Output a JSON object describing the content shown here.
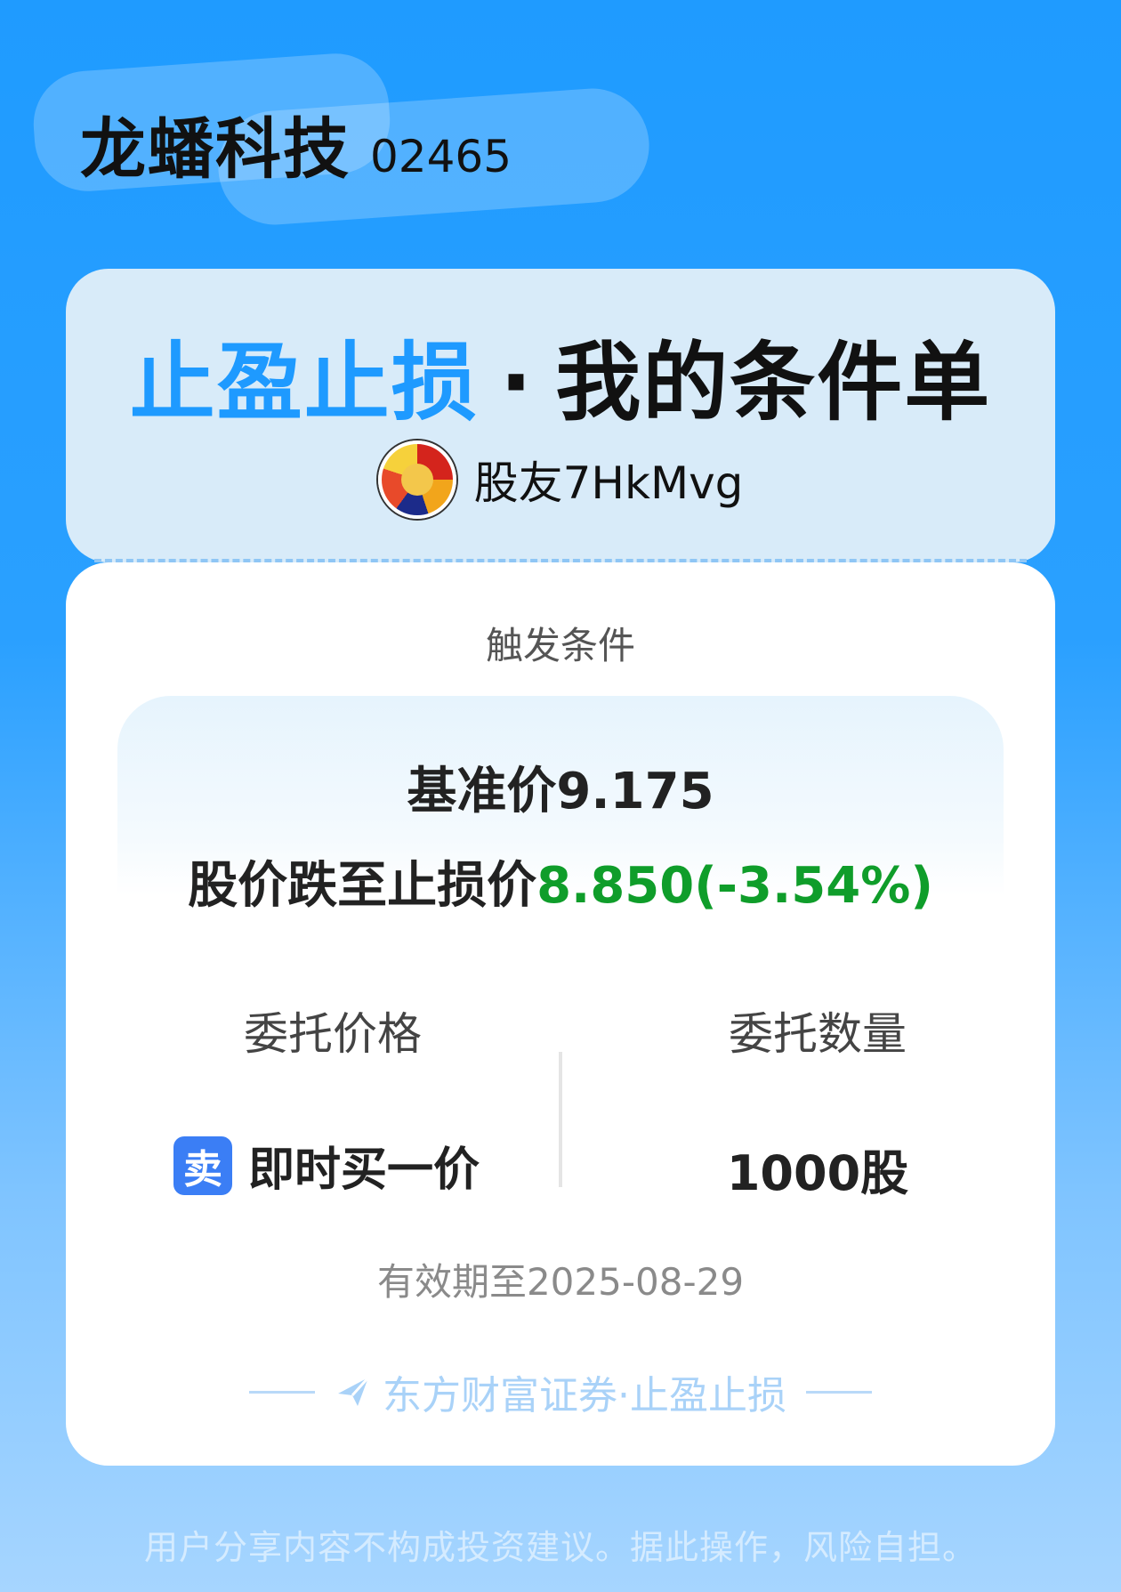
{
  "stock": {
    "name": "龙蟠科技",
    "code": "02465"
  },
  "card": {
    "title_blue": "止盈止损",
    "title_separator": "·",
    "title_black": "我的条件单",
    "username": "股友7HkMvg",
    "avatar_icon": "avatar-image"
  },
  "condition": {
    "label": "触发条件",
    "base_price_text": "基准价9.175",
    "stop_prefix": "股价跌至止损价",
    "stop_value": "8.850(-3.54%)"
  },
  "order": {
    "price_label": "委托价格",
    "quantity_label": "委托数量",
    "side_badge": "卖",
    "price_type": "即时买一价",
    "quantity": "1000股"
  },
  "expiry_text": "有效期至2025-08-29",
  "brand_text": "东方财富证券·止盈止损",
  "disclaimer": "用户分享内容不构成投资建议。据此操作，风险自担。",
  "colors": {
    "background_top": "#1f9bff",
    "accent_blue": "#1e9aff",
    "down_green": "#0f9d2a",
    "sell_badge": "#3b7ef5"
  }
}
